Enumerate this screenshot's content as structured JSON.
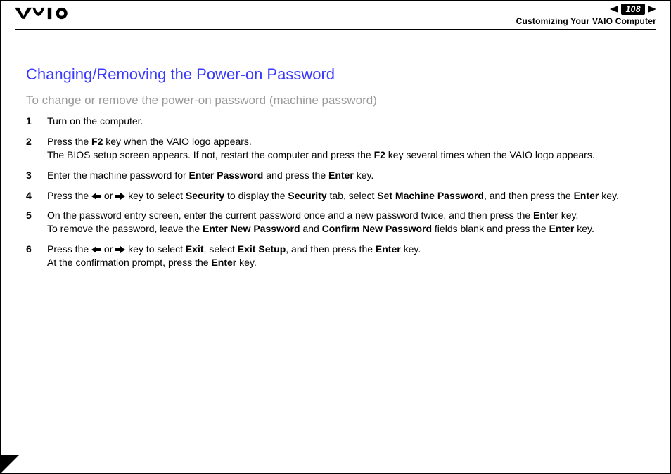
{
  "header": {
    "page_number": "108",
    "breadcrumb": "Customizing Your VAIO Computer"
  },
  "content": {
    "title": "Changing/Removing the Power-on Password",
    "subtitle": "To change or remove the power-on password (machine password)",
    "steps": [
      {
        "num": "1",
        "segments": [
          {
            "t": "Turn on the computer."
          }
        ]
      },
      {
        "num": "2",
        "segments": [
          {
            "t": "Press the "
          },
          {
            "t": "F2",
            "b": true
          },
          {
            "t": " key when the VAIO logo appears."
          },
          {
            "br": true
          },
          {
            "t": "The BIOS setup screen appears. If not, restart the computer and press the "
          },
          {
            "t": "F2",
            "b": true
          },
          {
            "t": " key several times when the VAIO logo appears."
          }
        ]
      },
      {
        "num": "3",
        "segments": [
          {
            "t": "Enter the machine password for "
          },
          {
            "t": "Enter Password",
            "b": true
          },
          {
            "t": " and press the "
          },
          {
            "t": "Enter",
            "b": true
          },
          {
            "t": " key."
          }
        ]
      },
      {
        "num": "4",
        "segments": [
          {
            "t": "Press the "
          },
          {
            "arrow": "left"
          },
          {
            "t": " or "
          },
          {
            "arrow": "right"
          },
          {
            "t": " key to select "
          },
          {
            "t": "Security",
            "b": true
          },
          {
            "t": " to display the "
          },
          {
            "t": "Security",
            "b": true
          },
          {
            "t": " tab, select "
          },
          {
            "t": "Set Machine Password",
            "b": true
          },
          {
            "t": ", and then press the "
          },
          {
            "t": "Enter",
            "b": true
          },
          {
            "t": " key."
          }
        ]
      },
      {
        "num": "5",
        "segments": [
          {
            "t": "On the password entry screen, enter the current password once and a new password twice, and then press the "
          },
          {
            "t": "Enter",
            "b": true
          },
          {
            "t": " key."
          },
          {
            "br": true
          },
          {
            "t": "To remove the password, leave the "
          },
          {
            "t": "Enter New Password",
            "b": true
          },
          {
            "t": " and "
          },
          {
            "t": "Confirm New Password",
            "b": true
          },
          {
            "t": " fields blank and press the "
          },
          {
            "t": "Enter",
            "b": true
          },
          {
            "t": " key."
          }
        ]
      },
      {
        "num": "6",
        "segments": [
          {
            "t": "Press the "
          },
          {
            "arrow": "left"
          },
          {
            "t": " or "
          },
          {
            "arrow": "right"
          },
          {
            "t": " key to select "
          },
          {
            "t": "Exit",
            "b": true
          },
          {
            "t": ", select "
          },
          {
            "t": "Exit Setup",
            "b": true
          },
          {
            "t": ", and then press the "
          },
          {
            "t": "Enter",
            "b": true
          },
          {
            "t": " key."
          },
          {
            "br": true
          },
          {
            "t": "At the confirmation prompt, press the "
          },
          {
            "t": "Enter",
            "b": true
          },
          {
            "t": " key."
          }
        ]
      }
    ]
  }
}
